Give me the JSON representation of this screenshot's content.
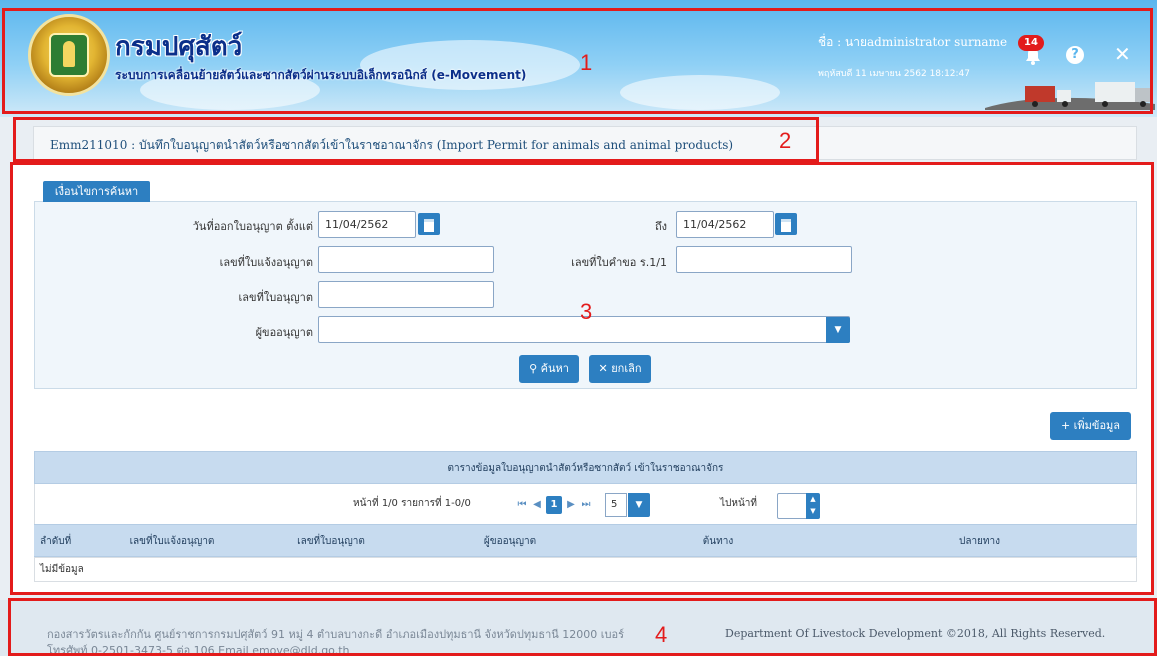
{
  "header": {
    "title": "กรมปศุสัตว์",
    "subtitle": "ระบบการเคลื่อนย้ายสัตว์และซากสัตว์ผ่านระบบอิเล็กทรอนิกส์ (e-Movement)",
    "user_label": "ชื่อ : นายadministrator surname",
    "datetime": "พฤหัสบดี 11 เมษายน 2562 18:12:47",
    "notification_count": "14"
  },
  "page": {
    "title": "Emm211010 : บันทึกใบอนุญาตนำสัตว์หรือซากสัตว์เข้าในราชอาณาจักร (Import Permit for animals and animal products)"
  },
  "search": {
    "tab_label": "เงื่อนไขการค้นหา",
    "date_from_label": "วันที่ออกใบอนุญาต ตั้งแต่",
    "date_from_value": "11/04/2562",
    "date_to_label": "ถึง",
    "date_to_value": "11/04/2562",
    "notify_no_label": "เลขที่ใบแจ้งอนุญาต",
    "notify_no_value": "",
    "request_no_label": "เลขที่ใบคำขอ ร.1/1",
    "request_no_value": "",
    "permit_no_label": "เลขที่ใบอนุญาต",
    "permit_no_value": "",
    "applicant_label": "ผู้ขออนุญาต",
    "applicant_value": "",
    "search_button": "ค้นหา",
    "cancel_button": "ยกเลิก"
  },
  "add_button": "เพิ่มข้อมูล",
  "table": {
    "caption": "ตารางข้อมูลใบอนุญาตนำสัตว์หรือซากสัตว์ เข้าในราชอาณาจักร",
    "pager_info": "หน้าที่ 1/0 รายการที่ 1-0/0",
    "current_page": "1",
    "page_size": "5",
    "goto_label": "ไปหน้าที่",
    "goto_value": "",
    "columns": [
      "ลำดับที่",
      "เลขที่ใบแจ้งอนุญาต",
      "เลขที่ใบอนุญาต",
      "ผู้ขออนุญาต",
      "ต้นทาง",
      "ปลายทาง"
    ],
    "empty_text": "ไม่มีข้อมูล"
  },
  "footer": {
    "address": "กองสารวัตรและกักกัน ศูนย์ราชการกรมปศุสัตว์ 91 หมู่ 4 ตำบลบางกะดี อำเภอเมืองปทุมธานี จังหวัดปทุมธานี 12000 เบอร์โทรศัพท์ 0-2501-3473-5 ต่อ 106 Email emove@dld.go.th",
    "copyright": "Department Of Livestock Development ©2018, All Rights Reserved."
  },
  "annotations": [
    "1",
    "2",
    "3",
    "4"
  ],
  "colors": {
    "primary": "#2d7fc1",
    "annotation_red": "#e31b1b",
    "header_sky": "#5bb6ee"
  }
}
